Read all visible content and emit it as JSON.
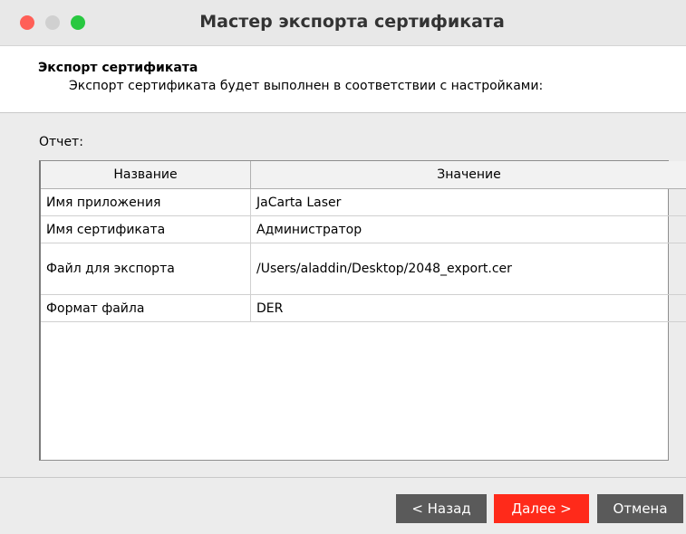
{
  "window": {
    "title": "Мастер экспорта сертификата"
  },
  "header": {
    "title": "Экспорт сертификата",
    "description": "Экспорт сертификата будет выполнен в соответствии с настройками:"
  },
  "report": {
    "label": "Отчет:",
    "columns": [
      "Название",
      "Значение"
    ],
    "rows": [
      {
        "name": "Имя приложения",
        "value": "JaCarta Laser"
      },
      {
        "name": "Имя сертификата",
        "value": "Администратор"
      },
      {
        "name": "Файл для экспорта",
        "value": "/Users/aladdin/Desktop/2048_export.cer"
      },
      {
        "name": "Формат файла",
        "value": "DER"
      }
    ]
  },
  "buttons": {
    "back": "< Назад",
    "next": "Далее >",
    "cancel": "Отмена"
  },
  "colors": {
    "close": "#ff5f57",
    "minimize": "#d0d0d0",
    "maximize": "#28c840",
    "primary_button": "#ff2a1a",
    "secondary_button": "#5a5a5a"
  }
}
